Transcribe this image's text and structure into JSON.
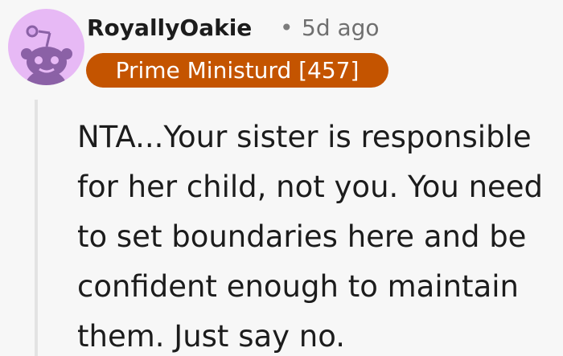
{
  "comment": {
    "author": {
      "username": "RoyallyOakie",
      "avatar_icon": "snoo-avatar-icon",
      "avatar_color": "#e7b9f5"
    },
    "separator": "•",
    "timestamp": "5d ago",
    "flair": {
      "text": "Prime Ministurd [457]",
      "background": "#c45400",
      "color": "#ffffff"
    },
    "body": "NTA...Your sister is responsible for her child, not you. You need to set boundaries here and be confident enough to maintain them. Just say no."
  }
}
